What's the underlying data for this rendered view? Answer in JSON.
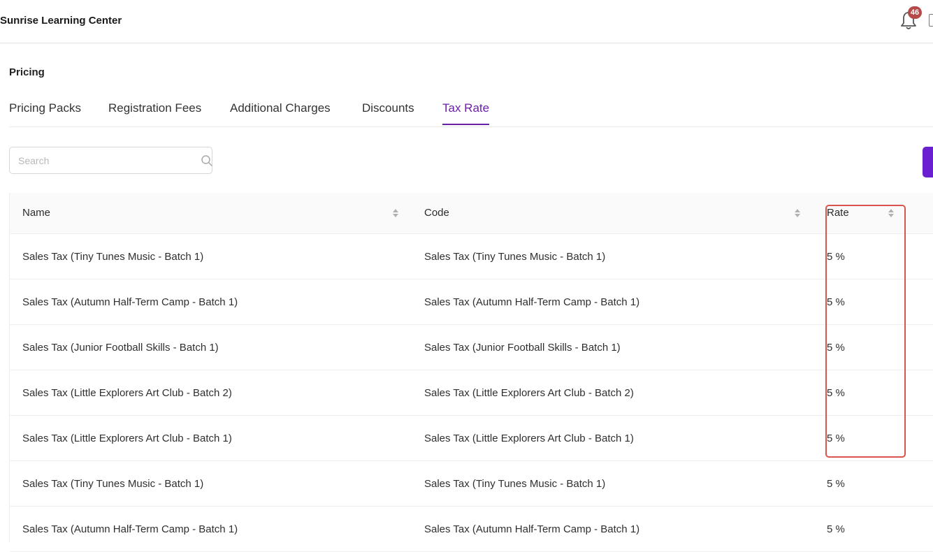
{
  "header": {
    "app_title": "Sunrise Learning Center",
    "notification_count": "46"
  },
  "page": {
    "section_title": "Pricing",
    "tabs": [
      {
        "label": "Pricing Packs",
        "active": false
      },
      {
        "label": "Registration Fees",
        "active": false
      },
      {
        "label": "Additional Charges",
        "active": false
      },
      {
        "label": "Discounts",
        "active": false
      },
      {
        "label": "Tax Rate",
        "active": true
      }
    ]
  },
  "search": {
    "placeholder": "Search",
    "value": ""
  },
  "table": {
    "columns": [
      "Name",
      "Code",
      "Rate"
    ],
    "rows": [
      {
        "name": "Sales Tax (Tiny Tunes Music - Batch 1)",
        "code": "Sales Tax (Tiny Tunes Music - Batch 1)",
        "rate": "5 %"
      },
      {
        "name": "Sales Tax (Autumn Half-Term Camp - Batch 1)",
        "code": "Sales Tax (Autumn Half-Term Camp - Batch 1)",
        "rate": "5 %"
      },
      {
        "name": "Sales Tax (Junior Football Skills - Batch 1)",
        "code": "Sales Tax (Junior Football Skills - Batch 1)",
        "rate": "5 %"
      },
      {
        "name": "Sales Tax (Little Explorers Art Club - Batch 2)",
        "code": "Sales Tax (Little Explorers Art Club - Batch 2)",
        "rate": "5 %"
      },
      {
        "name": "Sales Tax (Little Explorers Art Club - Batch 1)",
        "code": "Sales Tax (Little Explorers Art Club - Batch 1)",
        "rate": "5 %"
      },
      {
        "name": "Sales Tax (Tiny Tunes Music - Batch 1)",
        "code": "Sales Tax (Tiny Tunes Music - Batch 1)",
        "rate": "5 %"
      },
      {
        "name": "Sales Tax (Autumn Half-Term Camp - Batch 1)",
        "code": "Sales Tax (Autumn Half-Term Camp - Batch 1)",
        "rate": "5 %"
      }
    ]
  },
  "colors": {
    "accent": "#6a1fa8",
    "button": "#6a1fd0",
    "badge": "#b54a4a",
    "highlight": "#d9534f"
  },
  "icons": {
    "notification": "bell-icon",
    "search": "search-icon",
    "sort": "sort-icon"
  }
}
